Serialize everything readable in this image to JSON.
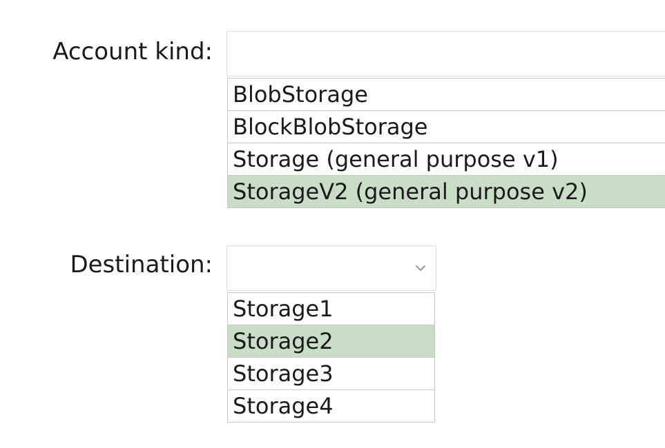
{
  "account_kind": {
    "label": "Account kind:",
    "selected_value": "",
    "options": [
      {
        "label": "BlobStorage",
        "selected": false
      },
      {
        "label": "BlockBlobStorage",
        "selected": false
      },
      {
        "label": "Storage (general purpose v1)",
        "selected": false
      },
      {
        "label": "StorageV2 (general purpose v2)",
        "selected": true
      }
    ]
  },
  "destination": {
    "label": "Destination:",
    "selected_value": "",
    "icon": "chevron-down-icon",
    "options": [
      {
        "label": "Storage1",
        "selected": false
      },
      {
        "label": "Storage2",
        "selected": true
      },
      {
        "label": "Storage3",
        "selected": false
      },
      {
        "label": "Storage4",
        "selected": false
      }
    ]
  },
  "colors": {
    "selected_highlight": "#c8dfc5",
    "border": "#c8c8c8",
    "text": "#1a1a1a"
  }
}
